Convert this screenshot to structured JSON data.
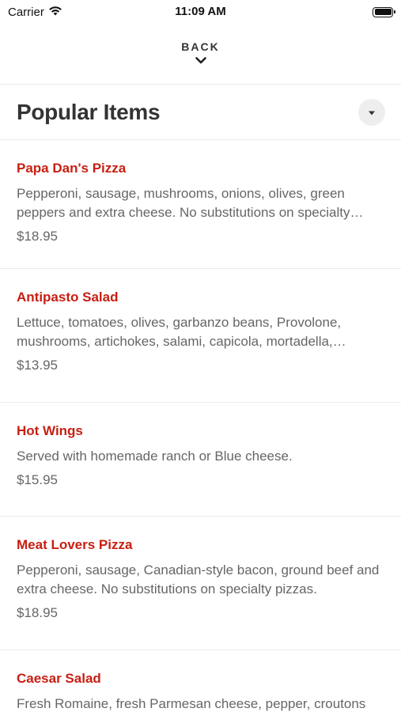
{
  "status_bar": {
    "carrier": "Carrier",
    "time": "11:09 AM"
  },
  "nav": {
    "back_label": "BACK"
  },
  "header": {
    "title": "Popular Items"
  },
  "items": [
    {
      "name": "Papa Dan's Pizza",
      "description": "Pepperoni, sausage, mushrooms, onions, olives, green peppers and extra cheese. No substitutions on specialty pizzas.",
      "price": "$18.95"
    },
    {
      "name": "Antipasto Salad",
      "description": "Lettuce, tomatoes, olives, garbanzo beans, Provolone, mushrooms, artichokes, salami, capicola, mortadella, pepperoncini.",
      "price": "$13.95"
    },
    {
      "name": "Hot Wings",
      "description": "Served with homemade ranch or Blue cheese.",
      "price": "$15.95"
    },
    {
      "name": "Meat Lovers Pizza",
      "description": "Pepperoni, sausage, Canadian-style bacon, ground beef and extra cheese. No substitutions on specialty pizzas.",
      "price": "$18.95"
    },
    {
      "name": "Caesar Salad",
      "description": "Fresh Romaine, fresh Parmesan cheese, pepper, croutons",
      "price": ""
    }
  ],
  "colors": {
    "accent": "#c81e12",
    "text_secondary": "#666666",
    "divider": "#ececec"
  }
}
